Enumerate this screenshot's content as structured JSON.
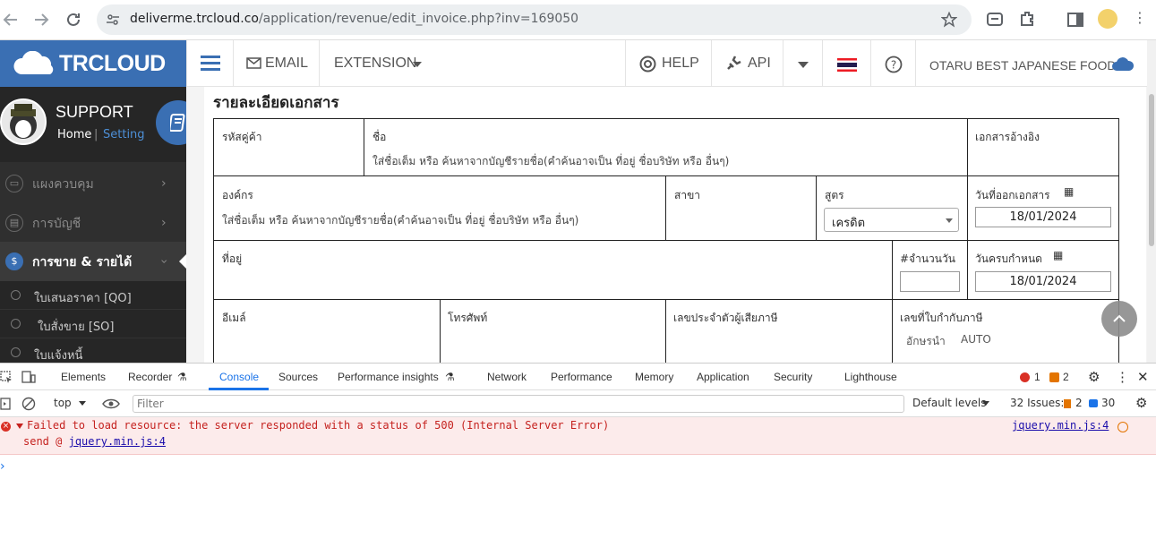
{
  "browser": {
    "url_domain": "deliverme.trcloud.co",
    "url_path": "/application/revenue/edit_invoice.php?inv=169050"
  },
  "header": {
    "logo_text": "TRCLOUD",
    "email_label": "EMAIL",
    "extension_label": "EXTENSION",
    "help_label": "HELP",
    "api_label": "API",
    "company_name": "OTARU BEST JAPANESE FOOD"
  },
  "sidebar": {
    "profile_name": "SUPPORT",
    "home_link": "Home",
    "separator": "|",
    "setting_link": "Setting",
    "items": [
      {
        "label": "แผงควบคุม"
      },
      {
        "label": "การบัญชี"
      },
      {
        "label": "การขาย & รายได้"
      }
    ],
    "subitems": [
      {
        "label": "ใบเสนอราคา [QO]"
      },
      {
        "label": "ใบสั่งขาย [SO]"
      },
      {
        "label": "ใบแจ้งหนี้"
      }
    ]
  },
  "form": {
    "title": "รายละเอียดเอกสาร",
    "customer_code_label": "รหัสคู่ค้า",
    "name_label": "ชื่อ",
    "name_placeholder": "ใส่ชื่อเต็ม หรือ ค้นหาจากบัญชีรายชื่อ(คำค้นอาจเป็น ที่อยู่ ชื่อบริษัท หรือ อื่นๆ)",
    "reference_label": "เอกสารอ้างอิง",
    "organization_label": "องค์กร",
    "organization_placeholder": "ใส่ชื่อเต็ม หรือ ค้นหาจากบัญชีรายชื่อ(คำค้นอาจเป็น ที่อยู่ ชื่อบริษัท หรือ อื่นๆ)",
    "branch_label": "สาขา",
    "formula_label": "สูตร",
    "formula_value": "เครดิต",
    "issue_date_label": "วันที่ออกเอกสาร",
    "issue_date_value": "18/01/2024",
    "address_label": "ที่อยู่",
    "days_label": "#จำนวนวัน",
    "days_value": "",
    "due_date_label": "วันครบกำหนด",
    "due_date_value": "18/01/2024",
    "email_label": "อีเมล์",
    "phone_label": "โทรศัพท์",
    "tax_id_label": "เลขประจำตัวผู้เสียภาษี",
    "tax_invoice_label": "เลขที่ใบกำกับภาษี",
    "prefix_label": "อักษรนำ",
    "prefix_value": "AUTO"
  },
  "devtools": {
    "tabs": [
      "Elements",
      "Recorder",
      "Console",
      "Sources",
      "Performance insights",
      "Network",
      "Performance",
      "Memory",
      "Application",
      "Security",
      "Lighthouse"
    ],
    "error_count": "1",
    "warning_count": "2",
    "context": "top",
    "filter_placeholder": "Filter",
    "levels": "Default levels",
    "issues_label": "32 Issues:",
    "issues_warn": "2",
    "issues_info": "30",
    "error_message": "Failed to load resource: the server responded with a status of 500 (Internal Server Error)",
    "error_send": "send @",
    "error_send_link": "jquery.min.js:4",
    "error_source": "jquery.min.js:4"
  }
}
